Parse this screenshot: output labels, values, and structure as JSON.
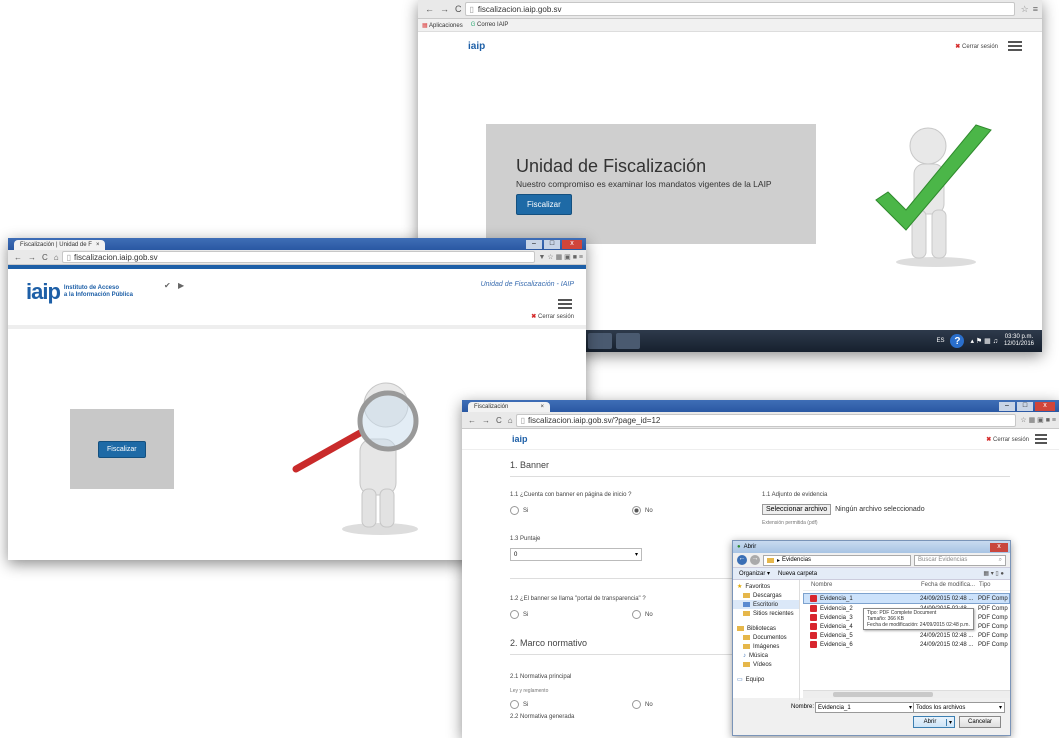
{
  "window_top": {
    "url": "fiscalizacion.iaip.gob.sv",
    "bookmarks": [
      "Aplicaciones",
      "Correo IAIP"
    ],
    "logo_text": "iaip",
    "logout_label": "Cerrar sesión",
    "hero_title": "Unidad de Fiscalización",
    "hero_subtitle": "Nuestro compromiso es examinar los mandatos vigentes de la LAIP",
    "hero_button": "Fiscalizar",
    "taskbar_time": "03:30 p.m.",
    "taskbar_date": "12/01/2016",
    "taskbar_lang": "ES"
  },
  "window_left": {
    "tab_title": "Fiscalización | Unidad de F",
    "url": "fiscalizacion.iaip.gob.sv",
    "logo_text": "iaip",
    "logo_line1": "Instituto de Acceso",
    "logo_line2": "a la Información Pública",
    "header_right": "Unidad de Fiscalización - IAIP",
    "logout_label": "Cerrar sesión",
    "button": "Fiscalizar"
  },
  "window_right": {
    "tab_title": "Fiscalización",
    "url": "fiscalizacion.iaip.gob.sv/?page_id=12",
    "logo_text": "iaip",
    "logout_label": "Cerrar sesión",
    "section1": "1. Banner",
    "q11": "1.1 ¿Cuenta con banner en página de inicio ?",
    "opt_si": "Si",
    "opt_no": "No",
    "attach_label": "1.1 Adjunto de evidencia",
    "select_file_btn": "Seleccionar archivo",
    "no_file": "Ningún archivo seleccionado",
    "ext_note": "Extensión permitida (pdf)",
    "q13": "1.3 Puntaje",
    "score_value": "0",
    "q12": "1.2 ¿El banner se llama \"portal de transparencia\" ?",
    "section2": "2. Marco normativo",
    "q21": "2.1 Normativa principal",
    "q21_sub": "Ley y reglamento",
    "q22": "2.2 Normativa generada"
  },
  "dialog": {
    "title": "Abrir",
    "path": "Evidencias",
    "search_placeholder": "Buscar Evidencias",
    "organize": "Organizar ▾",
    "new_folder": "Nueva carpeta",
    "col_name": "Nombre",
    "col_date": "Fecha de modifica...",
    "col_type": "Tipo",
    "sidebar": [
      "Favoritos",
      "Descargas",
      "Escritorio",
      "Sitios recientes",
      "Bibliotecas",
      "Documentos",
      "Imágenes",
      "Música",
      "Vídeos",
      "Equipo"
    ],
    "files": [
      {
        "name": "Evidencia_1",
        "date": "24/09/2015 02:48 ...",
        "type": "PDF Comp"
      },
      {
        "name": "Evidencia_2",
        "date": "24/09/2015 02:48 ...",
        "type": "PDF Comp"
      },
      {
        "name": "Evidencia_3",
        "date": "",
        "type": "PDF Comp"
      },
      {
        "name": "Evidencia_4",
        "date": "",
        "type": "PDF Comp"
      },
      {
        "name": "Evidencia_5",
        "date": "24/09/2015 02:48 ...",
        "type": "PDF Comp"
      },
      {
        "name": "Evidencia_6",
        "date": "24/09/2015 02:48 ...",
        "type": "PDF Comp"
      }
    ],
    "tooltip_type": "Tipo: PDF Complete Document",
    "tooltip_size": "Tamaño: 366 KB",
    "tooltip_date": "Fecha de modificación: 24/09/2015 02:48 p.m.",
    "filename_label": "Nombre:",
    "filename_value": "Evidencia_1",
    "filter": "Todos los archivos",
    "open_btn": "Abrir",
    "cancel_btn": "Cancelar"
  }
}
